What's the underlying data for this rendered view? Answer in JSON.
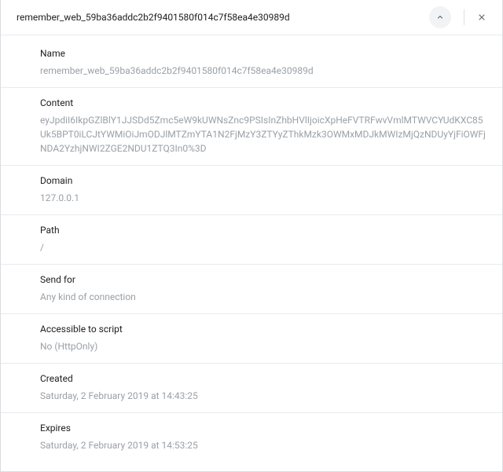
{
  "header": {
    "title": "remember_web_59ba36addc2b2f9401580f014c7f58ea4e30989d"
  },
  "fields": [
    {
      "label": "Name",
      "value": "remember_web_59ba36addc2b2f9401580f014c7f58ea4e30989d"
    },
    {
      "label": "Content",
      "value": "eyJpdiI6IkpGZlBlY1JJSDd5Zmc5eW9kUWNsZnc9PSIsInZhbHVlIjoicXpHeFVTRFwvVmlMTWVCYUdKXC85Uk5BPT0iLCJtYWMiOiJmODJlMTZmYTA1N2FjMzY3ZTYyZThkMzk3OWMxMDJkMWIzMjQzNDUyYjFiOWFjNDA2YzhjNWI2ZGE2NDU1ZTQ3In0%3D"
    },
    {
      "label": "Domain",
      "value": "127.0.0.1"
    },
    {
      "label": "Path",
      "value": "/"
    },
    {
      "label": "Send for",
      "value": "Any kind of connection"
    },
    {
      "label": "Accessible to script",
      "value": "No (HttpOnly)"
    },
    {
      "label": "Created",
      "value": "Saturday, 2 February 2019 at 14:43:25"
    },
    {
      "label": "Expires",
      "value": "Saturday, 2 February 2019 at 14:53:25"
    }
  ]
}
